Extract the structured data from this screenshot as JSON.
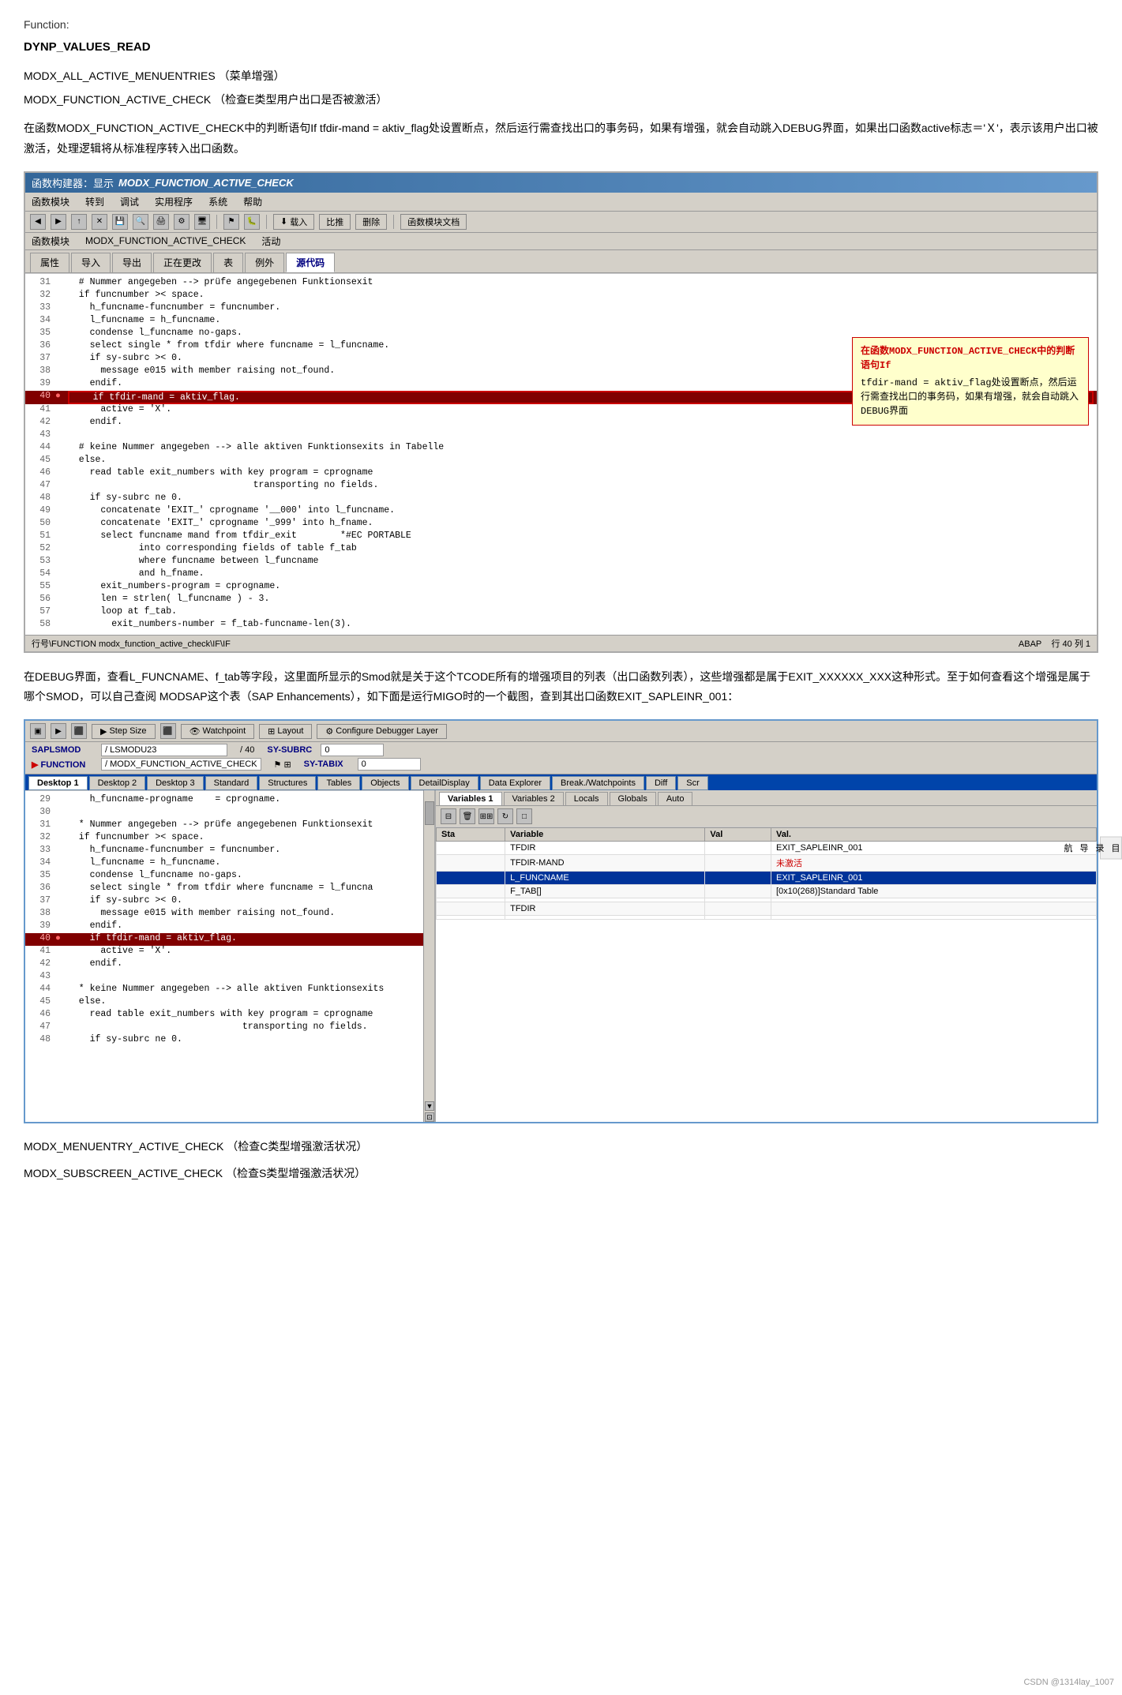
{
  "page": {
    "function_label": "Function:",
    "function_name": "DYNP_VALUES_READ",
    "entries": [
      {
        "name": "MODX_ALL_ACTIVE_MENUENTRIES",
        "cn": "（菜单增强）"
      },
      {
        "name": "MODX_FUNCTION_ACTIVE_CHECK",
        "cn": "（检查E类型用户出口是否被激活）"
      }
    ],
    "description1": "在函数MODX_FUNCTION_ACTIVE_CHECK中的判断语句If tfdir-mand = aktiv_flag处设置断点，然后运行需查找出口的事务码，如果有增强，就会自动跳入DEBUG界面，如果出口函数active标志＝'Ｘ'，表示该用户出口被激活，处理逻辑将从标准程序转入出口函数。",
    "window1": {
      "title": "函数构建器：显示 MODX_FUNCTION_ACTIVE_CHECK",
      "menubar": [
        "函数模块",
        "转到",
        "调试",
        "实用程序",
        "系统",
        "帮助"
      ],
      "toolbar_items": [
        "返回",
        "取消",
        "保存",
        "调试",
        "直接调试"
      ],
      "info": {
        "label": "函数模块",
        "value": "MODX_FUNCTION_ACTIVE_CHECK",
        "status": "活动"
      },
      "tabs": [
        "属性",
        "导入",
        "导出",
        "正在更改",
        "表",
        "例外",
        "源代码"
      ],
      "active_tab": "源代码",
      "code_lines": [
        {
          "num": "31",
          "bp": "",
          "text": "  # Nummer angegeben --> prüfe angegebenen Funktionsexit"
        },
        {
          "num": "32",
          "bp": "",
          "text": "  if funcnumber >< space."
        },
        {
          "num": "33",
          "bp": "",
          "text": "    h_funcname-funcnumber = funcnumber."
        },
        {
          "num": "34",
          "bp": "",
          "text": "    l_funcname = h_funcname."
        },
        {
          "num": "35",
          "bp": "",
          "text": "    condense l_funcname no-gaps."
        },
        {
          "num": "36",
          "bp": "",
          "text": "    select single * from tfdir where funcname = l_funcname."
        },
        {
          "num": "37",
          "bp": "",
          "text": "    if sy-subrc >< 0."
        },
        {
          "num": "38",
          "bp": "",
          "text": "      message e015 with member raising not_found."
        },
        {
          "num": "39",
          "bp": "",
          "text": "    endif."
        },
        {
          "num": "40",
          "bp": "●",
          "text": "    if tfdir-mand = aktiv_flag.",
          "highlight": true
        },
        {
          "num": "41",
          "bp": "",
          "text": "      active = 'X'."
        },
        {
          "num": "42",
          "bp": "",
          "text": "    endif."
        },
        {
          "num": "43",
          "bp": "",
          "text": ""
        },
        {
          "num": "44",
          "bp": "",
          "text": "  # keine Nummer angegeben --> alle aktiven Funktionsexits in Tabelle"
        },
        {
          "num": "45",
          "bp": "",
          "text": "  else."
        },
        {
          "num": "46",
          "bp": "",
          "text": "    read table exit_numbers with key program = cprogname"
        },
        {
          "num": "47",
          "bp": "",
          "text": "                                  transporting no fields."
        },
        {
          "num": "48",
          "bp": "",
          "text": "    if sy-subrc ne 0."
        },
        {
          "num": "49",
          "bp": "",
          "text": "      concatenate 'EXIT_' cprogname '__000' into l_funcname."
        },
        {
          "num": "50",
          "bp": "",
          "text": "      concatenate 'EXIT_' cprogname '_999' into h_fname."
        },
        {
          "num": "51",
          "bp": "",
          "text": "      select funcname mand from tfdir_exit        *#EC PORTABLE"
        },
        {
          "num": "52",
          "bp": "",
          "text": "             into corresponding fields of table f_tab"
        },
        {
          "num": "53",
          "bp": "",
          "text": "             where funcname between l_funcname"
        },
        {
          "num": "54",
          "bp": "",
          "text": "             and h_fname."
        },
        {
          "num": "55",
          "bp": "",
          "text": "      exit_numbers-program = cprogname."
        },
        {
          "num": "56",
          "bp": "",
          "text": "      len = strlen( l_funcname ) - 3."
        },
        {
          "num": "57",
          "bp": "",
          "text": "      loop at f_tab."
        },
        {
          "num": "58",
          "bp": "",
          "text": "        exit_numbers-number = f_tab-funcname-len(3)."
        }
      ],
      "callout": {
        "title": "在函数MODX_FUNCTION_ACTIVE_CHECK中的判断语句If",
        "body": "tfdir-mand = aktiv_flag处设置断点，然后运行需查找出口的事务码，如果有增强，就会自动跳入DEBUG界面"
      },
      "statusbar": {
        "left": "行号\\FUNCTION modx_function_active_check\\IF\\IF",
        "right": "ABAP    行 40 列 1"
      }
    },
    "description2": "在DEBUG界面，查看L_FUNCNAME、f_tab等字段，这里面所显示的Smod就是关于这个TCODE所有的增强项目的列表（出口函数列表），这些增强都是属于EXIT_XXXXXX_XXX这种形式。至于如何查看这个增强是属于哪个SMOD，可以自己查阅 MODSAP这个表（SAP Enhancements），如下面是运行MIGO时的一个截图，查到其出口函数EXIT_SAPLEINR_001：",
    "debug_window": {
      "toolbar_items": [
        "Step Size",
        "Watchpoint",
        "Layout",
        "Configure Debugger Layer"
      ],
      "info_rows": [
        {
          "label1": "SAPLSMOD",
          "val1": "/ LSMODU23",
          "sep1": "/ 40",
          "label2": "SY-SUBRC",
          "val2": "0"
        },
        {
          "label1": "FUNCTION",
          "val1": "/ MODX_FUNCTION_ACTIVE_CHECK",
          "sep1": "",
          "label2": "SY-TABIX",
          "val2": "0"
        }
      ],
      "desktop_tabs": [
        "Desktop 1",
        "Desktop 2",
        "Desktop 3",
        "Standard",
        "Structures",
        "Tables",
        "Objects",
        "DetailDisplay",
        "Data Explorer",
        "Break./Watchpoints",
        "Diff",
        "Scr"
      ],
      "active_desktop": "Desktop 1",
      "code_lines": [
        {
          "num": "29",
          "bp": "",
          "text": "    h_funcname-progname    = cprogname."
        },
        {
          "num": "30",
          "bp": "",
          "text": ""
        },
        {
          "num": "31",
          "bp": "",
          "text": "  * Nummer angegeben --> prüfe angegebenen Funktionsexit"
        },
        {
          "num": "32",
          "bp": "",
          "text": "  if funcnumber >< space."
        },
        {
          "num": "33",
          "bp": "",
          "text": "    h_funcname-funcnumber = funcnumber."
        },
        {
          "num": "34",
          "bp": "",
          "text": "    l_funcname = h_funcname."
        },
        {
          "num": "35",
          "bp": "",
          "text": "    condense l_funcname no-gaps."
        },
        {
          "num": "36",
          "bp": "",
          "text": "    select single * from tfdir where funcname = l_funcna"
        },
        {
          "num": "37",
          "bp": "",
          "text": "    if sy-subrc >< 0."
        },
        {
          "num": "38",
          "bp": "",
          "text": "      message e015 with member raising not_found."
        },
        {
          "num": "39",
          "bp": "",
          "text": "    endif."
        },
        {
          "num": "40",
          "bp": "●",
          "text": "    if tfdir-mand = aktiv_flag.",
          "highlight": true
        },
        {
          "num": "41",
          "bp": "",
          "text": "      active = 'X'."
        },
        {
          "num": "42",
          "bp": "",
          "text": "    endif."
        },
        {
          "num": "43",
          "bp": "",
          "text": ""
        },
        {
          "num": "44",
          "bp": "",
          "text": "  * keine Nummer angegeben --> alle aktiven Funktionsexits"
        },
        {
          "num": "45",
          "bp": "",
          "text": "  else."
        },
        {
          "num": "46",
          "bp": "",
          "text": "    read table exit_numbers with key program = cprogname"
        },
        {
          "num": "47",
          "bp": "",
          "text": "                                transporting no fields."
        },
        {
          "num": "48",
          "bp": "",
          "text": "    if sy-subrc ne 0."
        }
      ],
      "vars_tabs": [
        "Variables 1",
        "Variables 2",
        "Locals",
        "Globals",
        "Auto"
      ],
      "active_vars_tab": "Variables 1",
      "vars_table": {
        "headers": [
          "Sta",
          "Variable",
          "Val",
          "Val."
        ],
        "rows": [
          {
            "sta": "",
            "variable": "TFDIR",
            "val": "",
            "value": "EXIT_SAPLEINR_001",
            "selected": false
          },
          {
            "sta": "",
            "variable": "TFDIR-MAND",
            "val": "",
            "value": "未激活",
            "value_red": true,
            "selected": false
          },
          {
            "sta": "",
            "variable": "L_FUNCNAME",
            "val": "",
            "value": "EXIT_SAPLEINR_001",
            "selected": true
          },
          {
            "sta": "",
            "variable": "F_TAB[]",
            "val": "",
            "value": "[0x10(268)]Standard Table",
            "selected": false
          },
          {
            "sta": "",
            "variable": "",
            "val": "",
            "value": "",
            "selected": false
          },
          {
            "sta": "",
            "variable": "TFDIR",
            "val": "",
            "value": "",
            "selected": false
          },
          {
            "sta": "",
            "variable": "",
            "val": "",
            "value": "",
            "selected": false
          }
        ]
      }
    },
    "bottom_entries": [
      {
        "name": "MODX_MENUENTRY_ACTIVE_CHECK",
        "cn": "（检查C类型增强激活状况）"
      },
      {
        "name": "MODX_SUBSCREEN_ACTIVE_CHECK",
        "cn": "（检查S类型增强激活状况）"
      }
    ],
    "watermark": "CSDN @1314lay_1007",
    "sidebar_nav": [
      "目",
      "录",
      "导",
      "航"
    ]
  }
}
